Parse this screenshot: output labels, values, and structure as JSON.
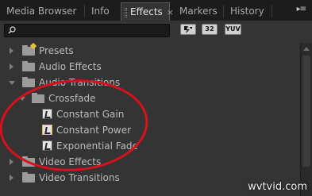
{
  "tabs": [
    {
      "label": "Media Browser",
      "active": false
    },
    {
      "label": "Info",
      "active": false
    },
    {
      "label": "Effects",
      "active": true
    },
    {
      "label": "Markers",
      "active": false
    },
    {
      "label": "History",
      "active": false
    }
  ],
  "tab_close_glyph": "×",
  "panel_menu_glyph": "▸≡",
  "search": {
    "value": "",
    "placeholder": ""
  },
  "filter_buttons": [
    "32",
    "YUV"
  ],
  "tree": {
    "presets": "Presets",
    "audio_effects": "Audio Effects",
    "audio_transitions": "Audio Transitions",
    "crossfade": "Crossfade",
    "constant_gain": "Constant Gain",
    "constant_power": "Constant Power",
    "exponential_fade": "Exponential Fade",
    "video_effects": "Video Effects",
    "video_transitions": "Video Transitions"
  },
  "annotation_color": "#d7111d",
  "watermark": "wvtvid.com"
}
